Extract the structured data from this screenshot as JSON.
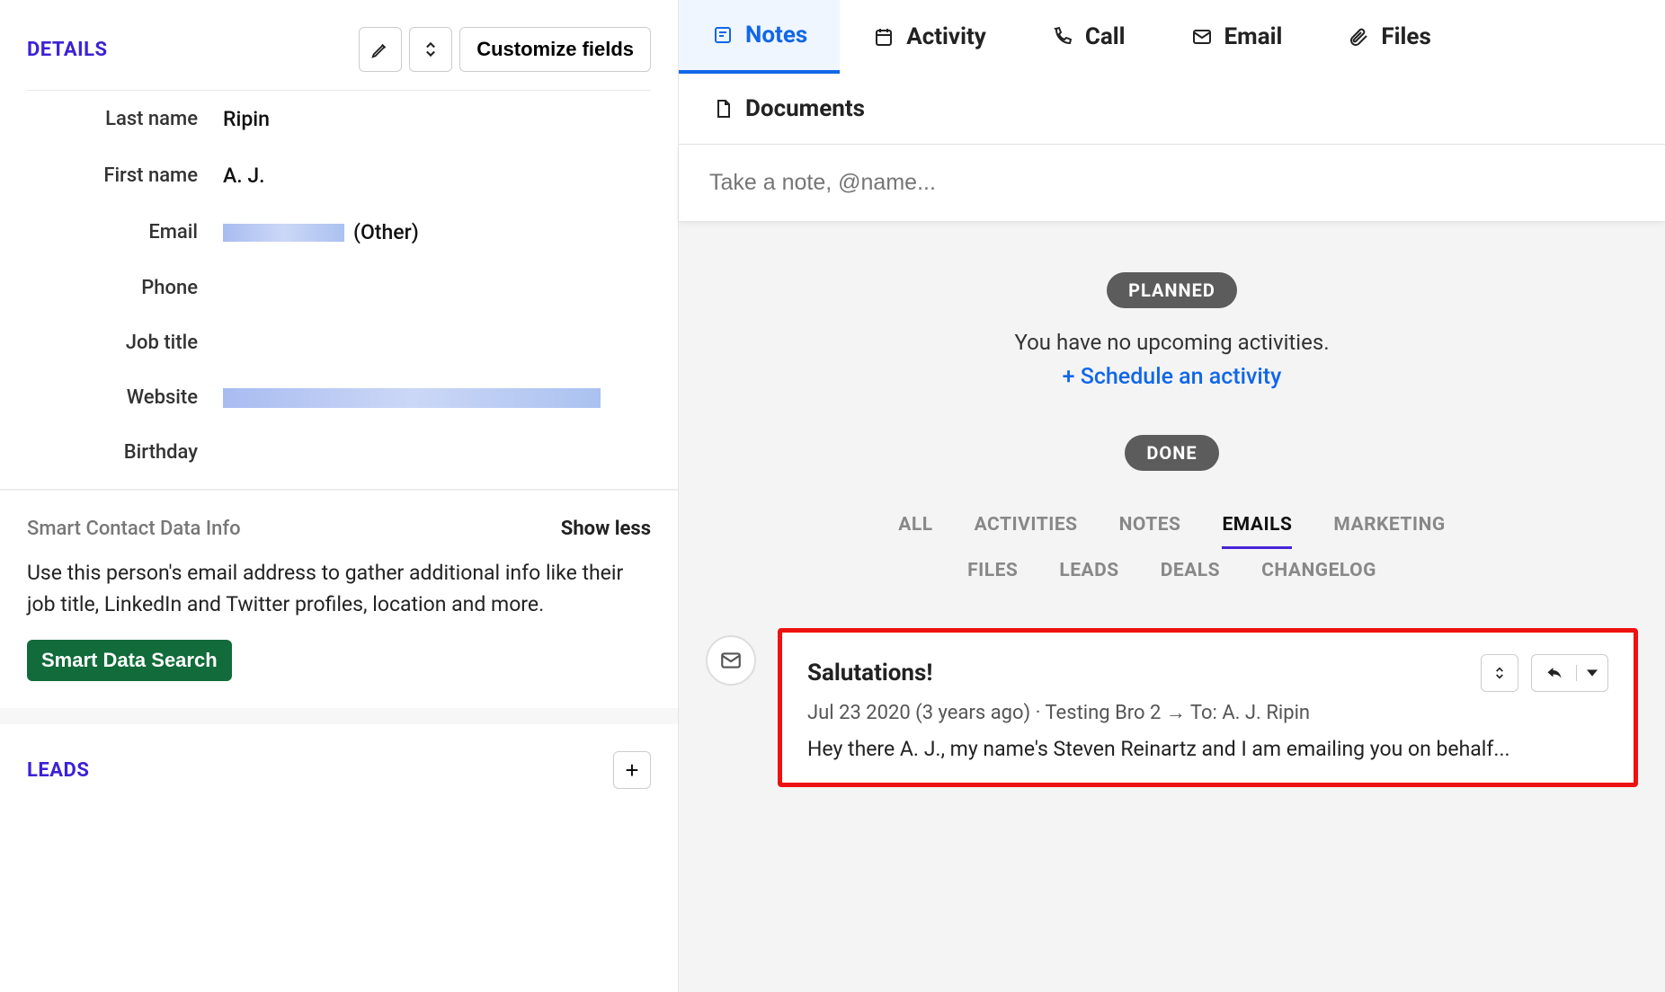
{
  "details": {
    "title": "DETAILS",
    "customize_label": "Customize fields",
    "fields": {
      "last_name_label": "Last name",
      "last_name_value": "Ripin",
      "first_name_label": "First name",
      "first_name_value": "A. J.",
      "email_label": "Email",
      "email_type": "(Other)",
      "phone_label": "Phone",
      "job_title_label": "Job title",
      "website_label": "Website",
      "birthday_label": "Birthday"
    }
  },
  "smart": {
    "title": "Smart Contact Data Info",
    "toggle": "Show less",
    "description": "Use this person's email address to gather additional info like their job title, LinkedIn and Twitter profiles, location and more.",
    "button": "Smart Data Search"
  },
  "leads": {
    "title": "LEADS"
  },
  "tabs": {
    "notes": "Notes",
    "activity": "Activity",
    "call": "Call",
    "email": "Email",
    "files": "Files",
    "documents": "Documents"
  },
  "note_placeholder": "Take a note, @name...",
  "planned": {
    "pill": "PLANNED",
    "empty": "You have no upcoming activities.",
    "schedule": "+ Schedule an activity"
  },
  "done": {
    "pill": "DONE",
    "filters": {
      "all": "ALL",
      "activities": "ACTIVITIES",
      "notes": "NOTES",
      "emails": "EMAILS",
      "marketing": "MARKETING",
      "files": "FILES",
      "leads": "LEADS",
      "deals": "DEALS",
      "changelog": "CHANGELOG"
    }
  },
  "email_card": {
    "subject": "Salutations!",
    "date": "Jul 23 2020 (3 years ago)",
    "from": "Testing Bro 2",
    "to_prefix": "To:",
    "to": "A. J. Ripin",
    "body": "Hey there A. J., my name's Steven Reinartz and I am emailing you on behalf..."
  },
  "colors": {
    "accent_purple": "#3b21d6",
    "accent_blue": "#1167e8",
    "green": "#116b3a",
    "highlight_red": "#e11"
  }
}
